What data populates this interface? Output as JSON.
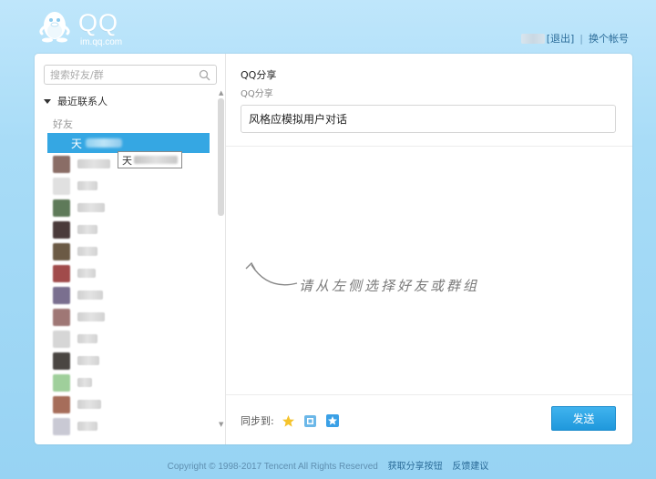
{
  "header": {
    "logo_text": "QQ",
    "logo_sub": "im.qq.com",
    "logout_label": "[退出]",
    "switch_account_label": "换个帐号",
    "separator": "|"
  },
  "sidebar": {
    "search_placeholder": "搜索好友/群",
    "group_title": "最近联系人",
    "sub_title": "好友",
    "selected_contact_prefix": "天",
    "tooltip_prefix": "天",
    "contacts": [
      {
        "avatar_color": "#8a6d66"
      },
      {
        "avatar_color": "#e0e0e0"
      },
      {
        "avatar_color": "#5e7a59"
      },
      {
        "avatar_color": "#4a3a3a"
      },
      {
        "avatar_color": "#6b5a45"
      },
      {
        "avatar_color": "#a14b4b"
      },
      {
        "avatar_color": "#7a6f8f"
      },
      {
        "avatar_color": "#9f7775"
      },
      {
        "avatar_color": "#d6d6d6"
      },
      {
        "avatar_color": "#4a4642"
      },
      {
        "avatar_color": "#9fcf9b"
      },
      {
        "avatar_color": "#a66d5a"
      },
      {
        "avatar_color": "#c9c9d4"
      }
    ],
    "selected_index": 0
  },
  "share": {
    "title": "QQ分享",
    "subtitle": "QQ分享",
    "message": "风格应模拟用户对话",
    "hint": "请从左侧选择好友或群组",
    "sync_label": "同步到:",
    "send_label": "发送",
    "icons": [
      "star-icon",
      "qzone-icon",
      "favorite-icon"
    ]
  },
  "footer": {
    "copyright": "Copyright © 1998-2017 Tencent All Rights Reserved",
    "get_button_link": "获取分享按钮",
    "feedback_link": "反馈建议"
  },
  "colors": {
    "accent": "#35a7e3",
    "background_top": "#bfe6fb",
    "background_bottom": "#97d3f3"
  }
}
